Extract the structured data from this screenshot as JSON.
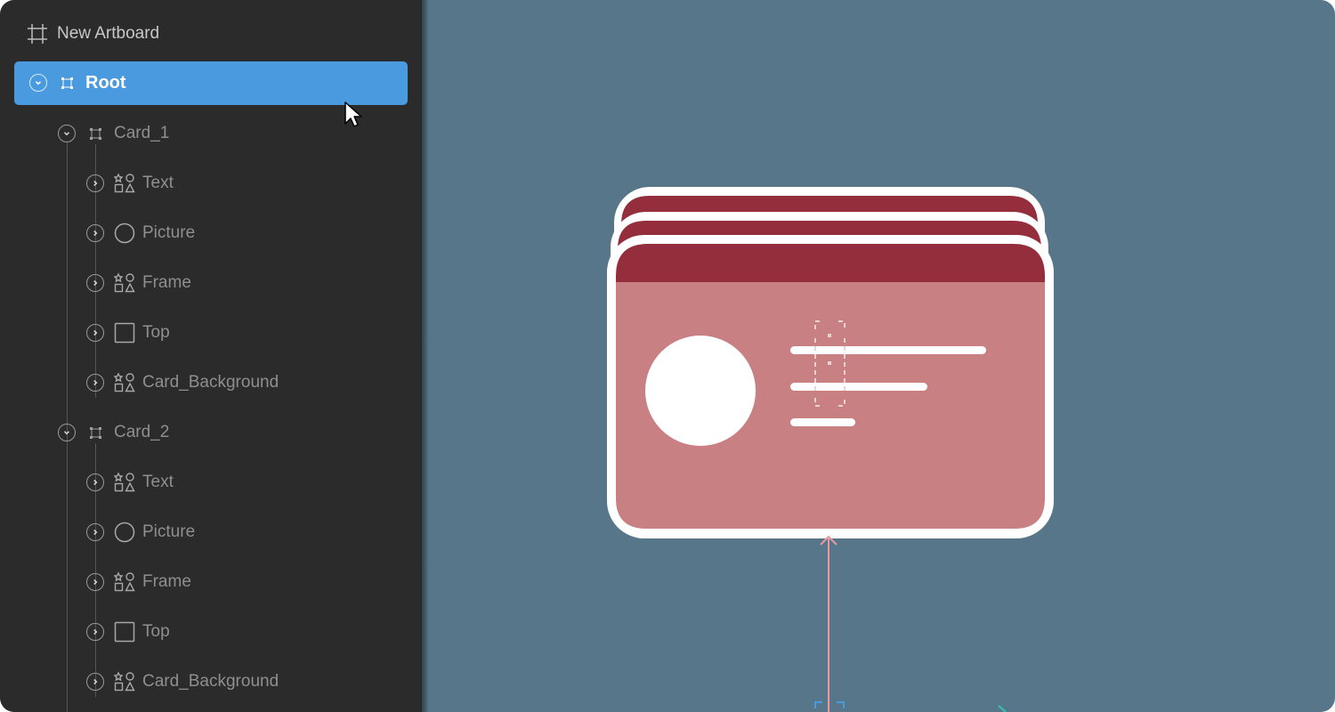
{
  "artboard": {
    "label": "New Artboard"
  },
  "root": {
    "label": "Root"
  },
  "groups": [
    {
      "name": "Card_1",
      "children": [
        "Text",
        "Picture",
        "Frame",
        "Top",
        "Card_Background"
      ]
    },
    {
      "name": "Card_2",
      "children": [
        "Text",
        "Picture",
        "Frame",
        "Top",
        "Card_Background"
      ]
    }
  ],
  "colors": {
    "sidebar_bg": "#2b2b2b",
    "selected_row": "#4a9adf",
    "canvas_bg": "#58768a",
    "card_header": "#952e3c",
    "card_body": "#c88082"
  }
}
